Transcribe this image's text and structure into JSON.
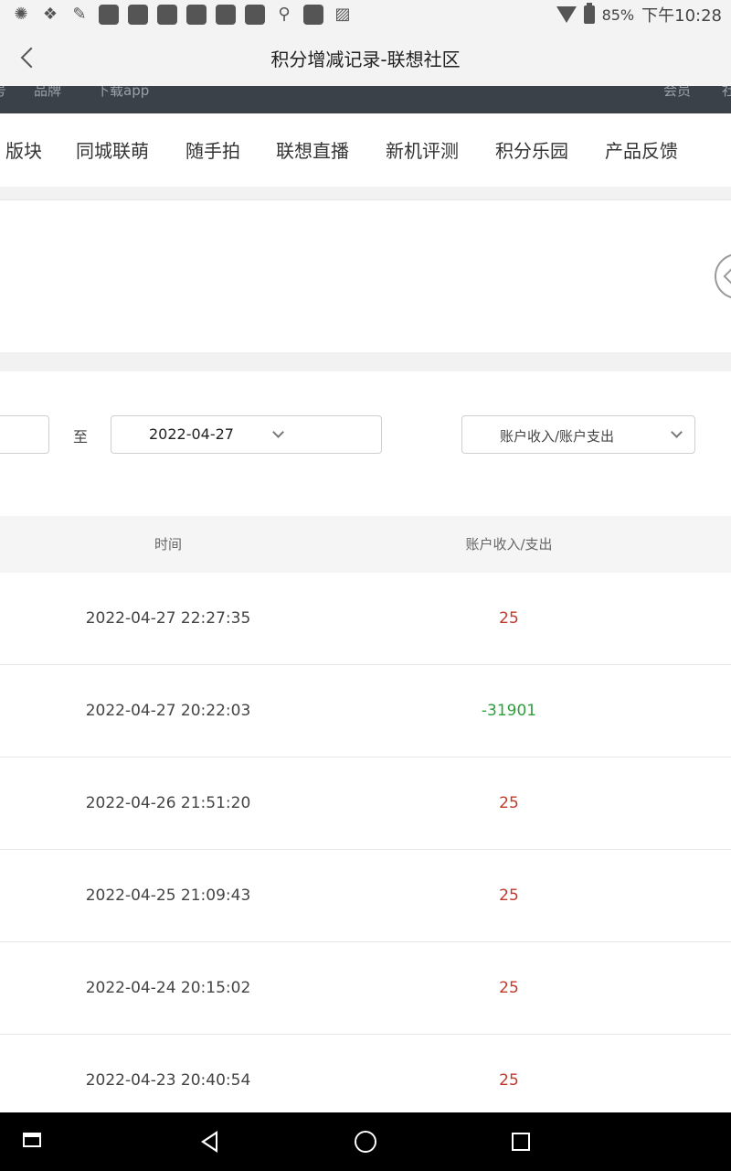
{
  "status_bar": {
    "battery": "85%",
    "time": "下午10:28"
  },
  "title_bar": {
    "title": "积分增减记录-联想社区"
  },
  "top_strip": {
    "items": [
      "号",
      "品牌",
      "下载app",
      "会员",
      "社"
    ]
  },
  "nav": {
    "items": [
      "版块",
      "同城联萌",
      "随手拍",
      "联想直播",
      "新机评测",
      "积分乐园",
      "产品反馈"
    ]
  },
  "filter": {
    "to_label": "至",
    "end_date": "2022-04-27",
    "type_selected": "账户收入/账户支出"
  },
  "table": {
    "headers": [
      "时间",
      "账户收入/支出"
    ],
    "rows": [
      {
        "time": "2022-04-27 22:27:35",
        "amount": "25"
      },
      {
        "time": "2022-04-27 20:22:03",
        "amount": "-31901"
      },
      {
        "time": "2022-04-26 21:51:20",
        "amount": "25"
      },
      {
        "time": "2022-04-25 21:09:43",
        "amount": "25"
      },
      {
        "time": "2022-04-24 20:15:02",
        "amount": "25"
      },
      {
        "time": "2022-04-23 20:40:54",
        "amount": "25"
      }
    ]
  },
  "colors": {
    "income": "#c0392b",
    "expense": "#2e9e3a",
    "dark_strip": "#3b4149"
  }
}
